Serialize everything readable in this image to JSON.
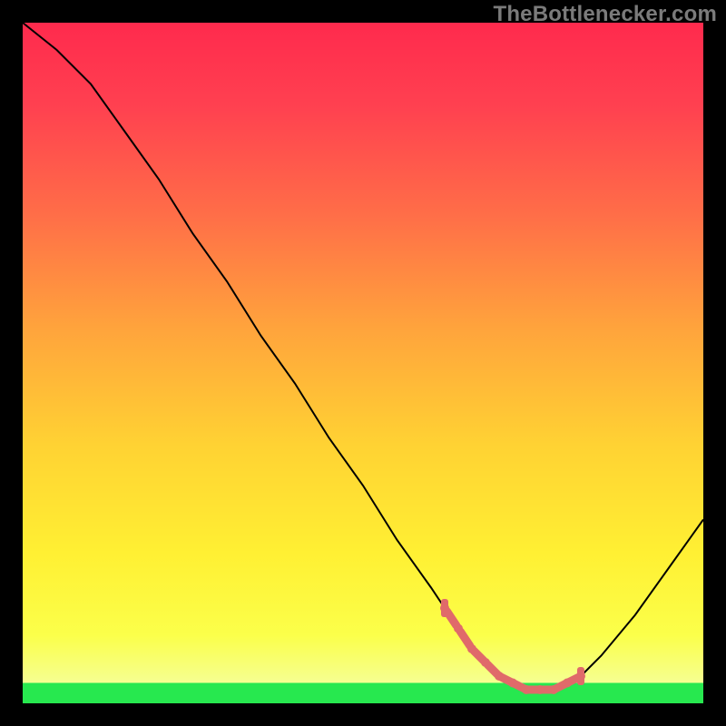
{
  "watermark": "TheBottlenecker.com",
  "chart_data": {
    "type": "line",
    "title": "",
    "xlabel": "",
    "ylabel": "",
    "xlim": [
      0,
      100
    ],
    "ylim": [
      0,
      100
    ],
    "grid": false,
    "background": "rainbow-gradient",
    "series": [
      {
        "name": "bottleneck-curve",
        "color": "#000000",
        "x": [
          0,
          5,
          10,
          15,
          20,
          25,
          30,
          35,
          40,
          45,
          50,
          55,
          60,
          62,
          64,
          66,
          68,
          70,
          72,
          74,
          76,
          78,
          80,
          82,
          85,
          90,
          95,
          100
        ],
        "y": [
          100,
          96,
          91,
          84,
          77,
          69,
          62,
          54,
          47,
          39,
          32,
          24,
          17,
          14,
          11,
          8,
          6,
          4,
          3,
          2,
          2,
          2,
          3,
          4,
          7,
          13,
          20,
          27
        ]
      },
      {
        "name": "optimal-zone-marker",
        "color": "#e06a6a",
        "x": [
          62,
          64,
          66,
          68,
          70,
          72,
          74,
          76,
          78,
          80,
          82
        ],
        "y": [
          14,
          11,
          8,
          6,
          4,
          3,
          2,
          2,
          2,
          3,
          4
        ]
      }
    ],
    "green_band_y_range": [
      0,
      3
    ]
  }
}
